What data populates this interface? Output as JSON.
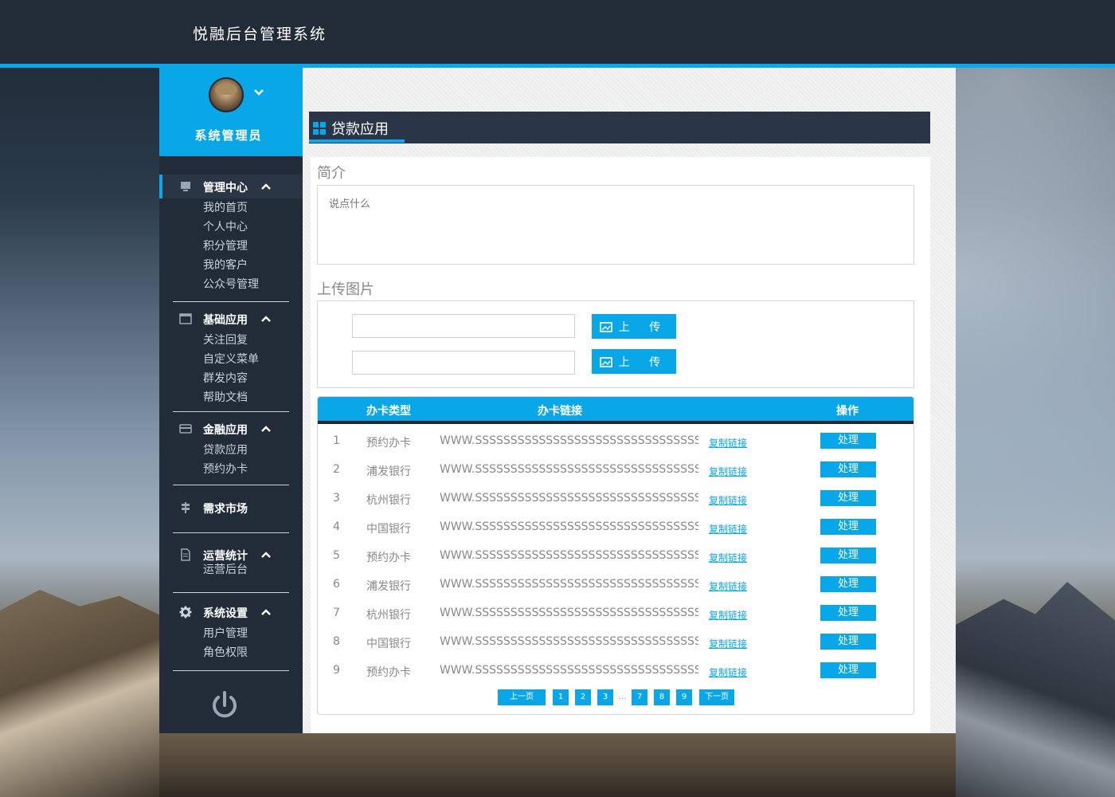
{
  "header": {
    "title": "悦融后台管理系统"
  },
  "sidebar": {
    "user": {
      "name": "系统管理员"
    },
    "groups": [
      {
        "label": "管理中心",
        "items": [
          "我的首页",
          "个人中心",
          "积分管理",
          "我的客户",
          "公众号管理"
        ]
      },
      {
        "label": "基础应用",
        "items": [
          "关注回复",
          "自定义菜单",
          "群发内容",
          "帮助文档"
        ]
      },
      {
        "label": "金融应用",
        "items": [
          "贷款应用",
          "预约办卡"
        ]
      },
      {
        "label": "需求市场",
        "items": []
      },
      {
        "label": "运营统计",
        "items": [
          "运营后台"
        ]
      },
      {
        "label": "系统设置",
        "items": [
          "用户管理",
          "角色权限"
        ]
      }
    ]
  },
  "main": {
    "section_title": "贷款应用",
    "intro_label": "简介",
    "intro_placeholder": "说点什么",
    "upload_label": "上传图片",
    "upload_button": "上 传",
    "table": {
      "headers": [
        "办卡类型",
        "办卡链接",
        "操作"
      ],
      "copy_label": "复制链接",
      "action_label": "处理",
      "rows": [
        {
          "num": "1",
          "type": "预约办卡",
          "url": "WWW.SSSSSSSSSSSSSSSSSSSSSSSSSSSSSSSSSSS.S"
        },
        {
          "num": "2",
          "type": "浦发银行",
          "url": "WWW.SSSSSSSSSSSSSSSSSSSSSSSSSSSSSSSSSSS.S"
        },
        {
          "num": "3",
          "type": "杭州银行",
          "url": "WWW.SSSSSSSSSSSSSSSSSSSSSSSSSSSSSSSSSSS.S"
        },
        {
          "num": "4",
          "type": "中国银行",
          "url": "WWW.SSSSSSSSSSSSSSSSSSSSSSSSSSSSSSSSSSS.S"
        },
        {
          "num": "5",
          "type": "预约办卡",
          "url": "WWW.SSSSSSSSSSSSSSSSSSSSSSSSSSSSSSSSSSS.S"
        },
        {
          "num": "6",
          "type": "浦发银行",
          "url": "WWW.SSSSSSSSSSSSSSSSSSSSSSSSSSSSSSSSSSS.S"
        },
        {
          "num": "7",
          "type": "杭州银行",
          "url": "WWW.SSSSSSSSSSSSSSSSSSSSSSSSSSSSSSSSSSS.S"
        },
        {
          "num": "8",
          "type": "中国银行",
          "url": "WWW.SSSSSSSSSSSSSSSSSSSSSSSSSSSSSSSSSSS.S"
        },
        {
          "num": "9",
          "type": "预约办卡",
          "url": "WWW.SSSSSSSSSSSSSSSSSSSSSSSSSSSSSSSSSSS.S"
        }
      ]
    },
    "pager": {
      "prev": "上一页",
      "next": "下一页",
      "pages": [
        "1",
        "2",
        "3",
        "7",
        "8",
        "9"
      ],
      "ellipsis": "..."
    }
  },
  "colors": {
    "accent": "#0aa7e8",
    "dark": "#222c39"
  },
  "icons": {
    "menu": [
      "monitor-icon",
      "window-icon",
      "card-icon",
      "signpost-icon",
      "document-icon",
      "gear-icon"
    ],
    "logout": "power-icon"
  }
}
